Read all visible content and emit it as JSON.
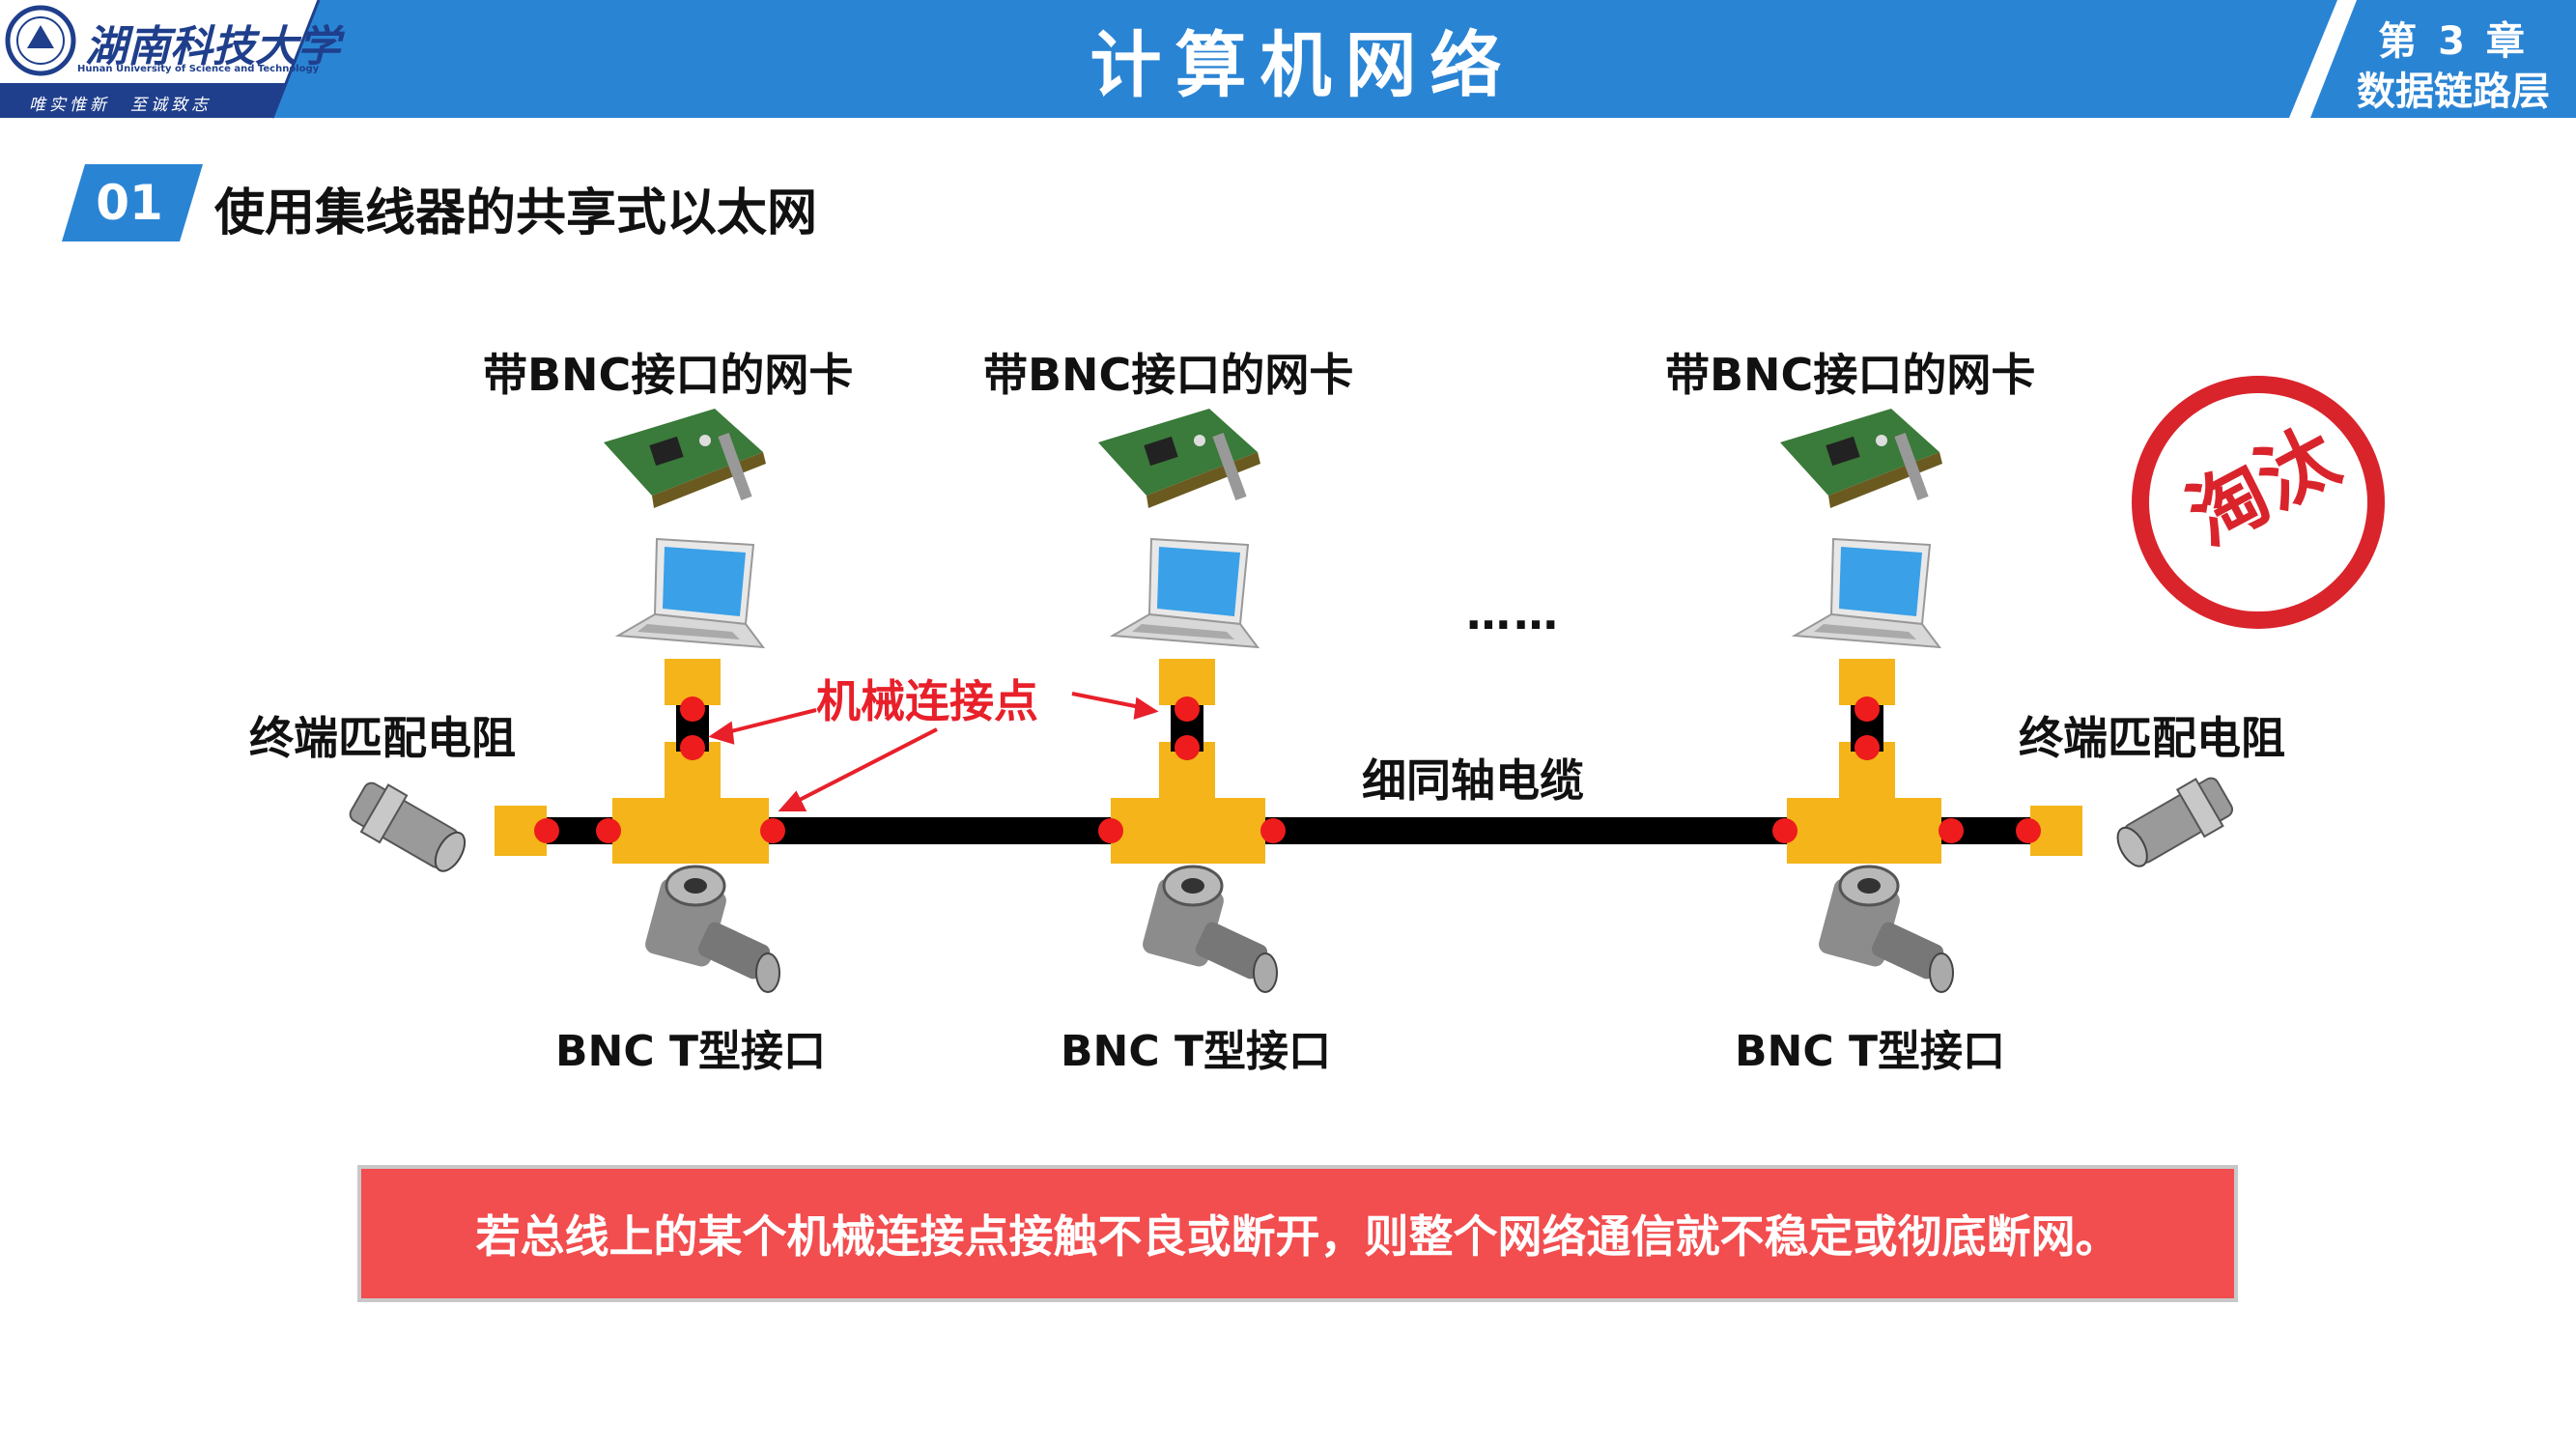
{
  "header": {
    "title": "计算机网络",
    "chapter_line1": "第 3 章",
    "chapter_line2": "数据链路层",
    "logo_name": "湖南科技大学",
    "logo_en": "Hunan University of Science and Technology",
    "motto": "唯实惟新　至诚致志",
    "bar_color": "#2a84d4"
  },
  "section": {
    "number": "01",
    "title": "使用集线器的共享式以太网"
  },
  "diagram": {
    "nic_labels": [
      "带BNC接口的网卡",
      "带BNC接口的网卡",
      "带BNC接口的网卡"
    ],
    "bnc_labels": [
      "BNC T型接口",
      "BNC T型接口",
      "BNC T型接口"
    ],
    "terminator_labels": [
      "终端匹配电阻",
      "终端匹配电阻"
    ],
    "cable_label": "细同轴电缆",
    "mechanical_point_label": "机械连接点",
    "ellipsis": "……",
    "stamp": "淘汰",
    "connector_color": "#f4b41a",
    "cable_color": "#000000",
    "joint_color": "#ee1c1c"
  },
  "note": "若总线上的某个机械连接点接触不良或断开，则整个网络通信就不稳定或彻底断网。"
}
